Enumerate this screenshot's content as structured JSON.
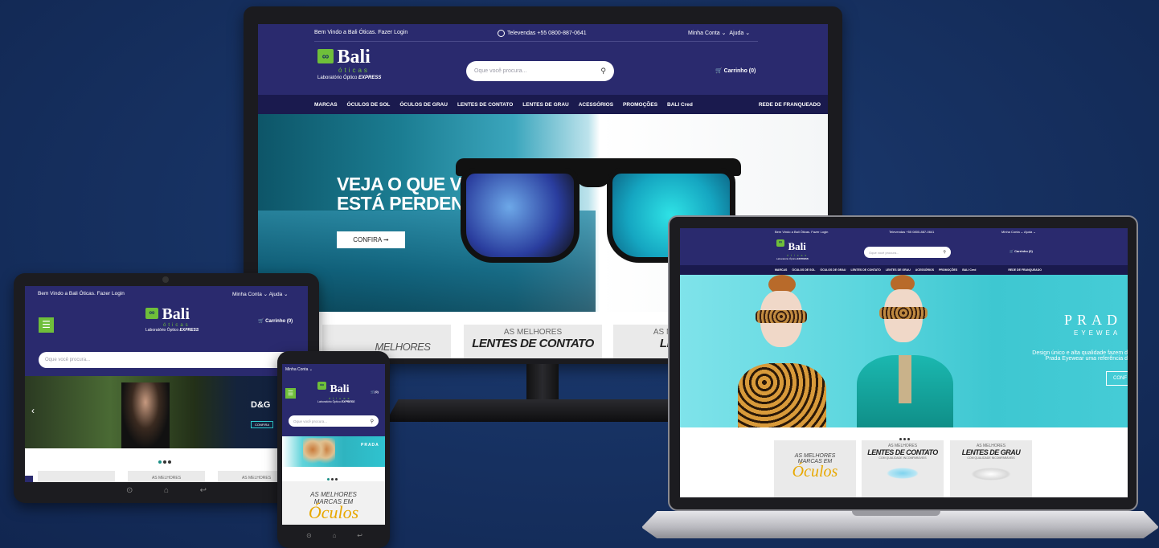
{
  "desktop": {
    "top_bar": {
      "welcome": "Bem Vindo a Bali Óticas. Fazer Login",
      "phone": "Televendas +55 0800-887-0641",
      "account": "Minha Conta",
      "help": "Ajuda"
    },
    "logo": {
      "name": "Bali",
      "sub": "óticas",
      "tag_prefix": "Laboratório Óptico",
      "tag_express": "EXPRESS"
    },
    "search_placeholder": "Oque você procura...",
    "cart": "Carrinho (0)",
    "nav": [
      "MARCAS",
      "ÓCULOS DE SOL",
      "ÓCULOS DE GRAU",
      "LENTES DE CONTATO",
      "LENTES DE GRAU",
      "ACESSÓRIOS",
      "PROMOÇÕES",
      "BALI Cred"
    ],
    "nav_right": "REDE DE FRANQUEADO",
    "hero": {
      "headline_line1": "VEJA O QUE VOCÊ",
      "headline_line2": "ESTÁ PERDENDO",
      "cta": "CONFIRA ➞"
    },
    "promos": [
      {
        "small": "AS",
        "big": "MELHORES"
      },
      {
        "small": "AS MELHORES",
        "big": "LENTES DE CONTATO"
      },
      {
        "small": "AS MELHORES",
        "big": "LENTES"
      }
    ]
  },
  "tablet": {
    "top_bar": {
      "welcome": "Bem Vindo a Bali Óticas. Fazer Login",
      "account": "Minha Conta",
      "help": "Ajuda"
    },
    "logo": {
      "name": "Bali",
      "sub": "óticas",
      "tag_prefix": "Laboratório Óptico",
      "tag_express": "EXPRESS"
    },
    "cart": "Carrinho (0)",
    "search_placeholder": "Oque você procura...",
    "hero_brand": "D&G",
    "hero_cta": "CONFIRA",
    "promos": [
      "AS MELHORES",
      "AS MELHORES"
    ]
  },
  "phone": {
    "account": "Minha Conta",
    "logo": {
      "name": "Bali",
      "sub": "óticas",
      "tag_prefix": "Laboratório Óptico",
      "tag_express": "EXPRESS"
    },
    "cart": "(0)",
    "search_placeholder": "Oque você procura...",
    "hero_brand": "PRADA",
    "promo": {
      "line1": "AS MELHORES",
      "line2": "MARCAS EM",
      "line3": "Óculos"
    }
  },
  "laptop": {
    "top_bar": {
      "welcome": "Bem Vindo a Bali Óticas. Fazer Login",
      "phone": "Televendas +55 0800-887-0641",
      "account": "Minha Conta",
      "help": "Ajuda"
    },
    "logo": {
      "name": "Bali",
      "sub": "óticas",
      "tag_prefix": "Laboratório Óptico",
      "tag_express": "EXPRESS"
    },
    "search_placeholder": "Oque você procura...",
    "cart": "Carrinho (0)",
    "nav": [
      "MARCAS",
      "ÓCULOS DE SOL",
      "ÓCULOS DE GRAU",
      "LENTES DE CONTATO",
      "LENTES DE GRAU",
      "ACESSÓRIOS",
      "PROMOÇÕES",
      "BALI Cred"
    ],
    "nav_right": "REDE DE FRANQUEADO",
    "hero": {
      "brand": "PRAD",
      "sub": "EYEWEA",
      "desc_line1": "Design único e alta qualidade fazem d",
      "desc_line2": "Prada Eyewear uma referência d",
      "cta": "CONF"
    },
    "promos": [
      {
        "small1": "AS MELHORES",
        "small2": "MARCAS EM",
        "big": "Óculos"
      },
      {
        "small1": "AS MELHORES",
        "big": "LENTES DE CONTATO",
        "caption": "COM QUALIDADE INCOMPARÁVEIS"
      },
      {
        "small1": "AS MELHORES",
        "big": "LENTES DE GRAU",
        "caption": "COM QUALIDADE INCOMPARÁVEIS"
      }
    ]
  },
  "colors": {
    "brand_navy": "#2a2a6e",
    "nav_dark": "#1a1a4e",
    "brand_green": "#6fbf3a",
    "accent_teal": "#1a8f86",
    "background": "#173263"
  }
}
